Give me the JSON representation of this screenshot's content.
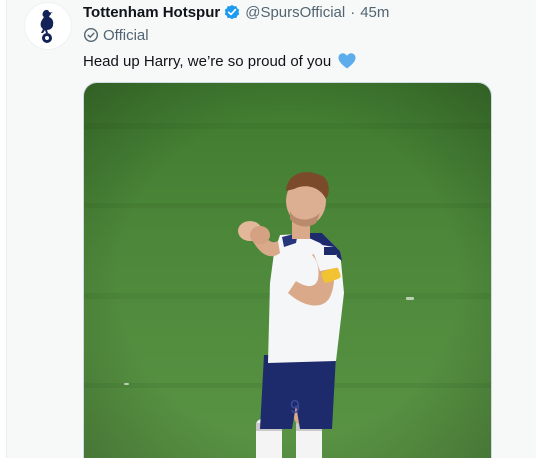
{
  "tweet": {
    "author": {
      "display_name": "Tottenham Hotspur",
      "handle": "@SpursOfficial",
      "separator": "·",
      "timestamp": "45m",
      "verified_icon": "verified-badge-icon",
      "label": "Official",
      "label_icon": "check-circle-icon",
      "avatar_icon": "cockerel-crest-icon"
    },
    "text": "Head up Harry, we’re so proud of you",
    "emoji_icon": "blue-heart-icon",
    "media": {
      "kind": "photo",
      "icon": "football-player-photo"
    }
  },
  "colors": {
    "background": "#f7f9f9",
    "name_text": "#0f1419",
    "secondary_text": "#536471",
    "verified_blue": "#1d9bf0",
    "heart_blue": "#5dadec",
    "pitch_green": "#4f8a3c",
    "spurs_navy": "#132257"
  }
}
